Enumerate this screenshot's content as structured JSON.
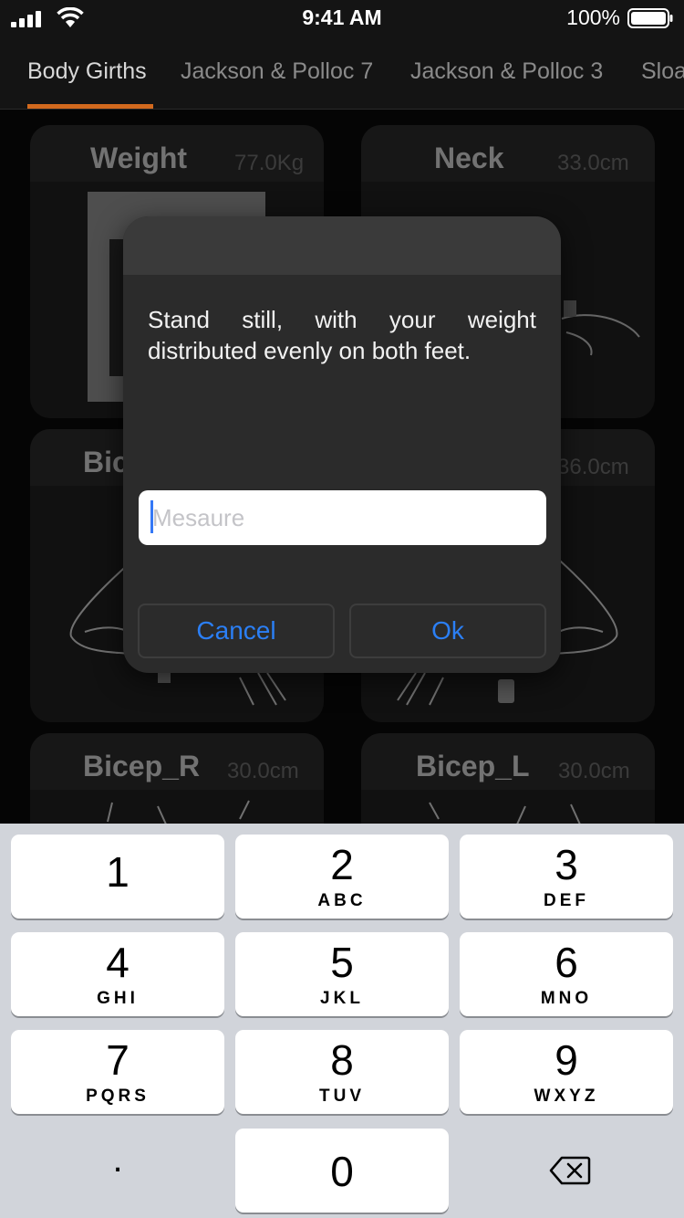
{
  "status_bar": {
    "time": "9:41 AM",
    "battery": "100%"
  },
  "tabs": [
    "Body Girths",
    "Jackson & Polloc 7",
    "Jackson & Polloc 3",
    "Sloa"
  ],
  "cards": [
    {
      "title": "Weight",
      "value": "77.0Kg"
    },
    {
      "title": "Neck",
      "value": "33.0cm"
    },
    {
      "title": "Bic",
      "value": ""
    },
    {
      "title": "",
      "value": "36.0cm"
    },
    {
      "title": "Bicep_R",
      "value": "30.0cm"
    },
    {
      "title": "Bicep_L",
      "value": "30.0cm"
    }
  ],
  "dialog": {
    "message": "Stand still, with your weight distributed evenly on both feet.",
    "input_placeholder": "Mesaure",
    "cancel_label": "Cancel",
    "ok_label": "Ok",
    "accent_color": "#2b7ff5"
  },
  "keypad": {
    "keys": [
      {
        "num": "1",
        "letters": ""
      },
      {
        "num": "2",
        "letters": "ABC"
      },
      {
        "num": "3",
        "letters": "DEF"
      },
      {
        "num": "4",
        "letters": "GHI"
      },
      {
        "num": "5",
        "letters": "JKL"
      },
      {
        "num": "6",
        "letters": "MNO"
      },
      {
        "num": "7",
        "letters": "PQRS"
      },
      {
        "num": "8",
        "letters": "TUV"
      },
      {
        "num": "9",
        "letters": "WXYZ"
      }
    ],
    "decimal": ".",
    "zero": "0"
  }
}
